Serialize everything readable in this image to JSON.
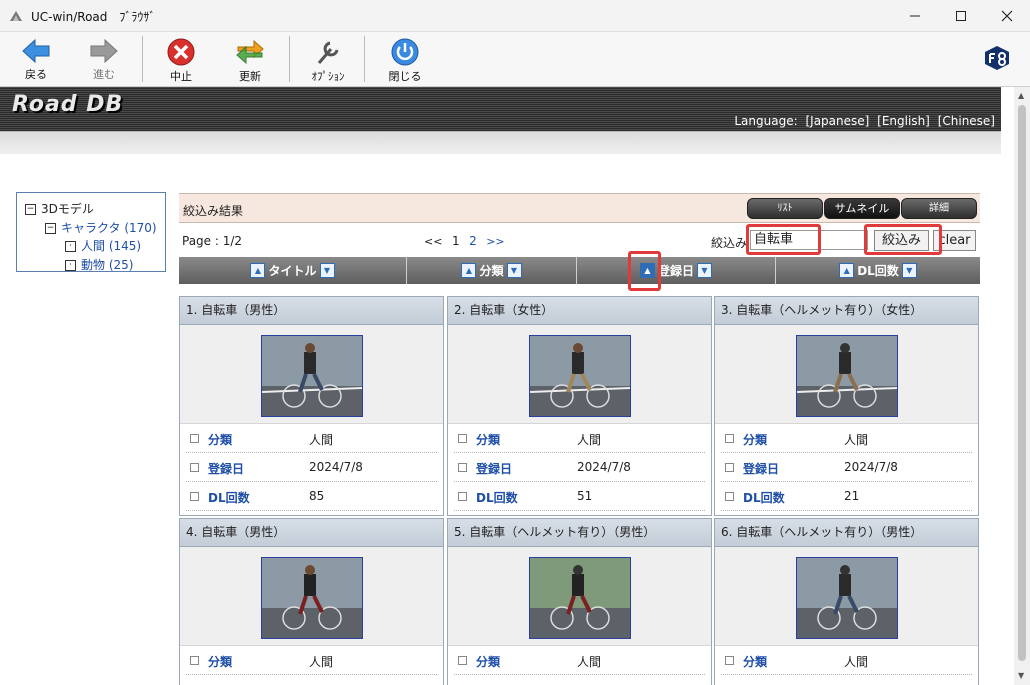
{
  "window": {
    "title": "UC-win/Road　ﾌﾞﾗｳｻﾞ"
  },
  "toolbar": {
    "back": "戻る",
    "forward": "進む",
    "stop": "中止",
    "refresh": "更新",
    "options": "ｵﾌﾟｼｮﾝ",
    "close": "閉じる"
  },
  "banner": {
    "logo": "Road DB",
    "language_label": "Language:",
    "languages": [
      "[Japanese]",
      "[English]",
      "[Chinese]"
    ]
  },
  "tree": {
    "root": "3Dモデル",
    "child": "キャラクタ (170)",
    "leaves": [
      "人間 (145)",
      "動物 (25)"
    ]
  },
  "results": {
    "title": "絞込み結果",
    "views": [
      "ﾘｽﾄ",
      "サムネイル",
      "詳細"
    ],
    "page_label": "Page : 1/2",
    "pager": {
      "prev": "<<",
      "pages": [
        "1",
        "2"
      ],
      "next": ">>"
    },
    "filter_label": "絞込み",
    "filter_value": "自転車",
    "filter_button": "絞込み",
    "clear_button": "clear",
    "sort_columns": [
      "タイトル",
      "分類",
      "登録日",
      "DL回数"
    ]
  },
  "cards": [
    {
      "title": "1. 自転車（男性）",
      "cat_label": "分類",
      "cat": "人間",
      "date_label": "登録日",
      "date": "2024/7/8",
      "dl_label": "DL回数",
      "dl": "85"
    },
    {
      "title": "2. 自転車（女性）",
      "cat_label": "分類",
      "cat": "人間",
      "date_label": "登録日",
      "date": "2024/7/8",
      "dl_label": "DL回数",
      "dl": "51"
    },
    {
      "title": "3. 自転車（ヘルメット有り）（女性）",
      "cat_label": "分類",
      "cat": "人間",
      "date_label": "登録日",
      "date": "2024/7/8",
      "dl_label": "DL回数",
      "dl": "21"
    },
    {
      "title": "4. 自転車（男性）",
      "cat_label": "分類",
      "cat": "人間"
    },
    {
      "title": "5. 自転車（ヘルメット有り）（男性）",
      "cat_label": "分類",
      "cat": "人間"
    },
    {
      "title": "6. 自転車（ヘルメット有り）（男性）",
      "cat_label": "分類",
      "cat": "人間"
    }
  ]
}
